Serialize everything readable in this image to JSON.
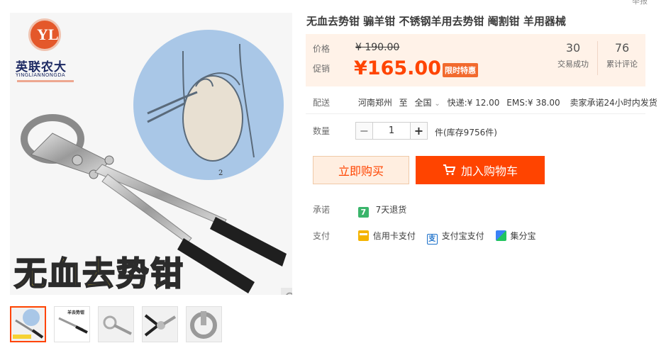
{
  "top_cut_text": "举报",
  "gallery": {
    "brand_name": "英联农大",
    "brand_en": "YINGLIANNONGDA",
    "logo_mark": "YL",
    "diagram_label": "2",
    "hero_text": "无血去势钳",
    "thumbnails": [
      {
        "name": "thumb-1",
        "active": true
      },
      {
        "name": "thumb-2",
        "active": false,
        "caption": "羊去势钳"
      },
      {
        "name": "thumb-3",
        "active": false
      },
      {
        "name": "thumb-4",
        "active": false
      },
      {
        "name": "thumb-5",
        "active": false
      }
    ]
  },
  "product": {
    "title": "无血去势钳 骟羊钳 不锈钢羊用去势钳 阉割钳 羊用器械",
    "price_label": "价格",
    "original_price": "¥ 190.00",
    "promo_label": "促销",
    "promo_price": "¥165.00",
    "promo_badge": "限时特惠",
    "stats": [
      {
        "num": "30",
        "label": "交易成功"
      },
      {
        "num": "76",
        "label": "累计评论"
      }
    ],
    "delivery": {
      "label": "配送",
      "from": "河南郑州",
      "to_word": "至",
      "to": "全国",
      "express": "快递:¥ 12.00",
      "ems": "EMS:¥ 38.00",
      "promise": "卖家承诺24小时内发货"
    },
    "quantity": {
      "label": "数量",
      "value": "1",
      "minus": "−",
      "plus": "+",
      "stock": "件(库存9756件)"
    },
    "buy_now": "立即购买",
    "add_to_cart": "加入购物车",
    "guarantee": {
      "label": "承诺",
      "icon_text": "7",
      "text": "7天退货"
    },
    "payment": {
      "label": "支付",
      "methods": [
        "信用卡支付",
        "支付宝支付",
        "集分宝"
      ]
    }
  },
  "colors": {
    "accent": "#ff4400",
    "price_bg": "#fff2e8"
  }
}
